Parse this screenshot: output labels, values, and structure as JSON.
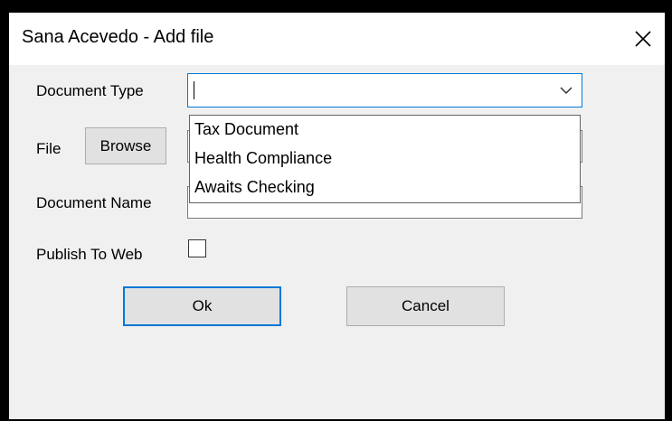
{
  "dialog": {
    "title": "Sana Acevedo - Add file",
    "close_icon": "close-icon"
  },
  "form": {
    "document_type_label": "Document Type",
    "document_type_value": "",
    "document_type_options": [
      "Tax Document",
      "Health Compliance",
      "Awaits Checking"
    ],
    "file_label": "File",
    "browse_label": "Browse",
    "document_name_label": "Document Name",
    "publish_label": "Publish To Web",
    "publish_checked": false
  },
  "buttons": {
    "ok_label": "Ok",
    "cancel_label": "Cancel"
  },
  "colors": {
    "focus_accent": "#0078d7",
    "button_face": "#e1e1e1",
    "dialog_background": "#f0f0f0"
  }
}
